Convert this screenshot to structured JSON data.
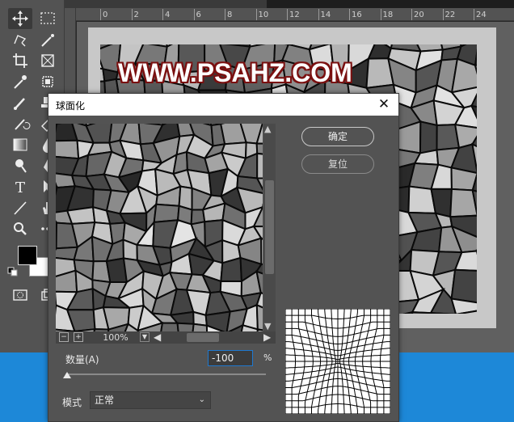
{
  "workspace": {
    "ruler_ticks": [
      "0",
      "2",
      "4",
      "6",
      "8",
      "10",
      "12",
      "14",
      "16",
      "18",
      "20",
      "22",
      "24"
    ]
  },
  "canvas": {
    "watermark": "WWW.PSAHZ.COM"
  },
  "dialog": {
    "title": "球面化",
    "close_glyph": "✕",
    "ok_label": "确定",
    "reset_label": "复位",
    "zoom_out": "−",
    "zoom_in": "+",
    "zoom_value": "100%",
    "amount_label": "数量(A)",
    "amount_value": "-100",
    "amount_unit": "%",
    "mode_label": "模式",
    "mode_value": "正常",
    "accent": "#1e78d0"
  },
  "icons": {
    "toolbar": [
      "move-icon",
      "marquee-icon",
      "lasso-icon",
      "magic-wand-icon",
      "crop-icon",
      "frame-icon",
      "eyedropper-icon",
      "patch-icon",
      "brush-icon",
      "stamp-icon",
      "history-brush-icon",
      "eraser-icon",
      "gradient-icon",
      "blur-icon",
      "dodge-icon",
      "pen-icon",
      "type-icon",
      "path-select-icon",
      "line-icon",
      "hand-icon",
      "zoom-icon",
      "more-icon",
      "quick-mask-icon",
      "screen-mode-icon"
    ]
  }
}
